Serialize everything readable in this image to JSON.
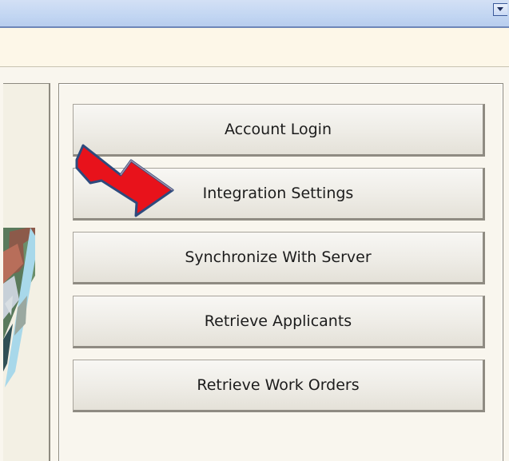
{
  "window": {
    "title_bar_control": "chevron-down-icon"
  },
  "left_panel": {
    "image": "city-photo"
  },
  "buttons": {
    "account_login": "Account Login",
    "integration_settings": "Integration Settings",
    "synchronize_with_server": "Synchronize With Server",
    "retrieve_applicants": "Retrieve Applicants",
    "retrieve_work_orders": "Retrieve Work Orders"
  },
  "annotation": {
    "arrow_color": "#e8121b",
    "arrow_outline": "#2e4a7d",
    "points_to": "integration_settings"
  },
  "colors": {
    "title_bar": "#c2d6f2",
    "toolbar_band": "#fdf7e8",
    "panel_background": "#f9f6ee"
  }
}
